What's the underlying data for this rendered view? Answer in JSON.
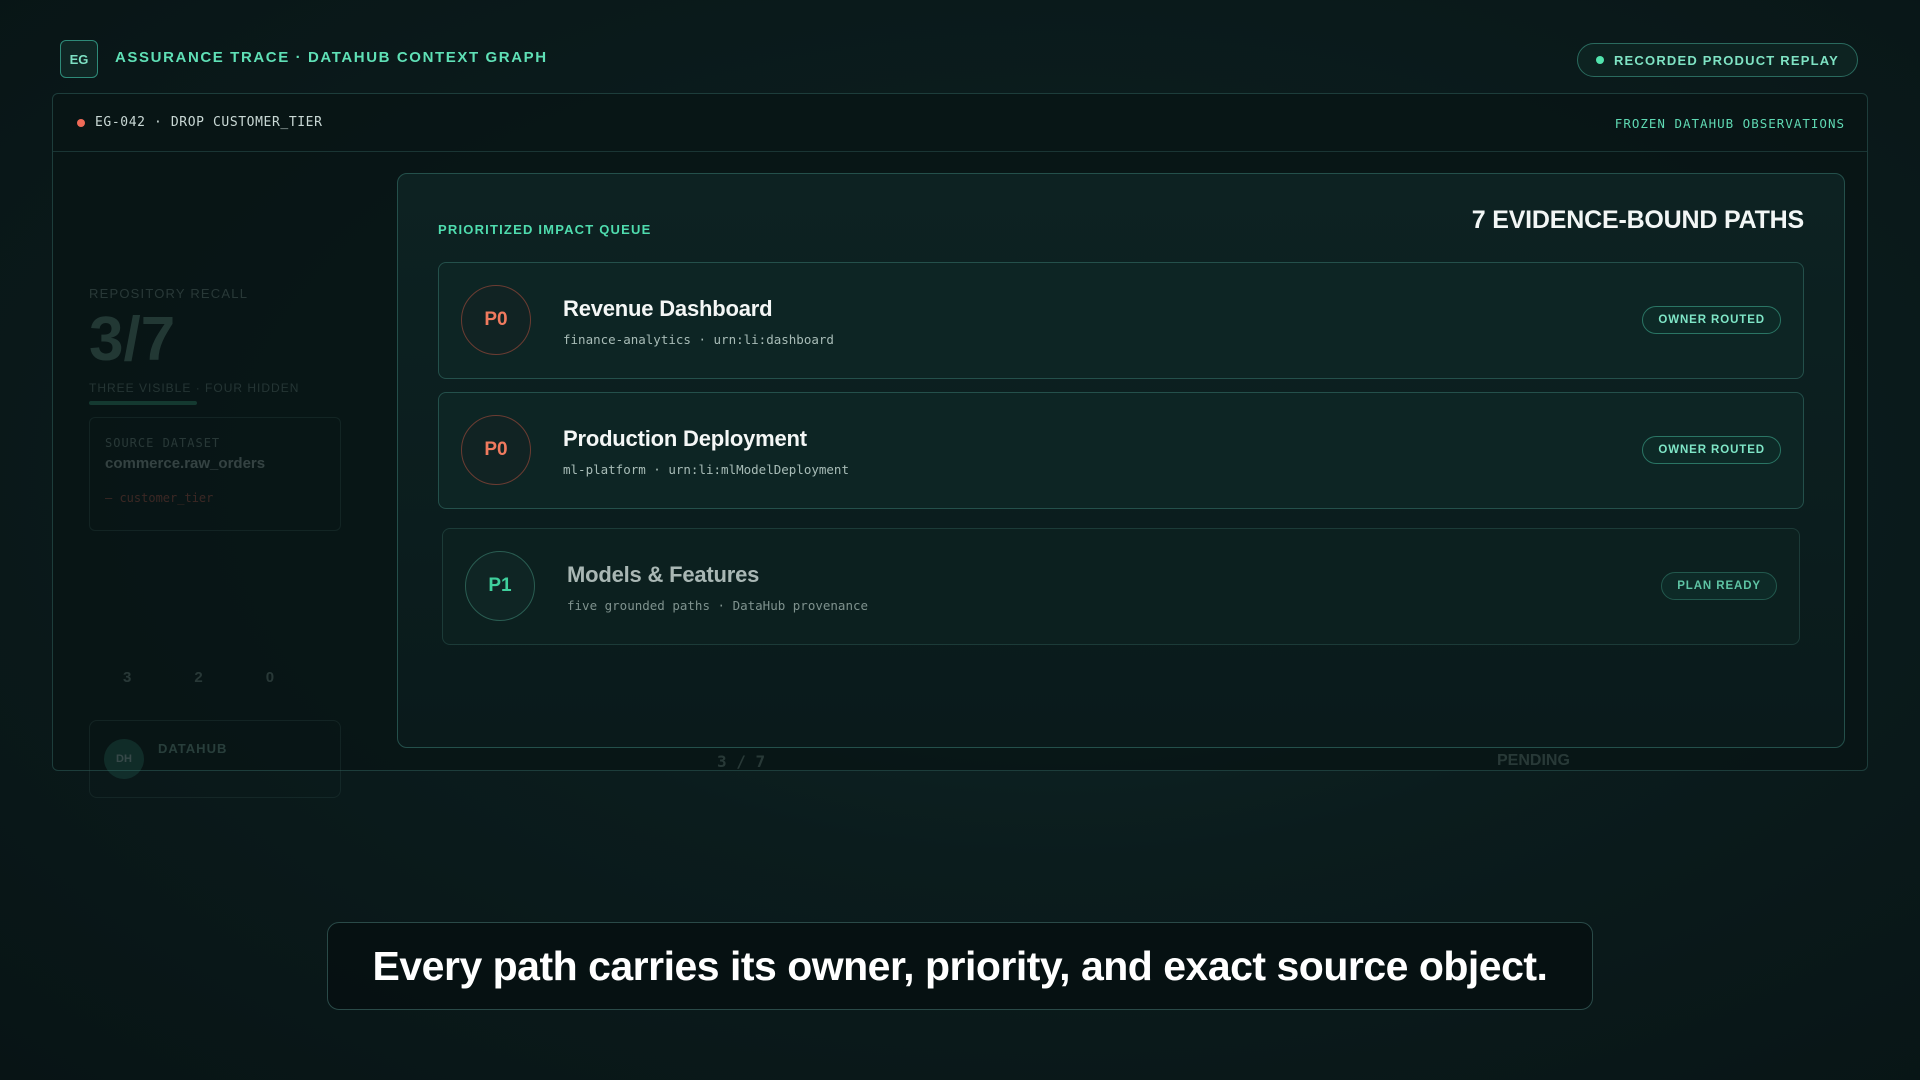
{
  "header": {
    "badge": "EG",
    "title": "ASSURANCE TRACE · DATAHUB CONTEXT GRAPH",
    "replay_label": "RECORDED PRODUCT REPLAY"
  },
  "window": {
    "incident": "EG-042 · DROP CUSTOMER_TIER",
    "mode": "FROZEN DATAHUB OBSERVATIONS"
  },
  "sidebar": {
    "recall_label": "REPOSITORY RECALL",
    "recall_value": "3/7",
    "recall_sub": "THREE VISIBLE · FOUR HIDDEN",
    "source_label": "SOURCE DATASET",
    "source_value": "commerce.raw_orders",
    "field": "— customer_tier",
    "counts": [
      "3",
      "2",
      "0"
    ],
    "dh_avatar": "DH",
    "dh_name": "DATAHUB"
  },
  "panel": {
    "kicker": "PRIORITIZED IMPACT QUEUE",
    "count_label": "7 EVIDENCE-BOUND PATHS",
    "rows": [
      {
        "priority": "P0",
        "title": "Revenue Dashboard",
        "meta": "finance-analytics · urn:li:dashboard",
        "status": "OWNER ROUTED"
      },
      {
        "priority": "P0",
        "title": "Production Deployment",
        "meta": "ml-platform · urn:li:mlModelDeployment",
        "status": "OWNER ROUTED"
      },
      {
        "priority": "P1",
        "title": "Models & Features",
        "meta": "five grounded paths · DataHub provenance",
        "status": "PLAN READY"
      }
    ]
  },
  "strip": {
    "ratio": "3 / 7",
    "status": "PENDING"
  },
  "caption": "Every path carries its owner, priority, and exact source object."
}
